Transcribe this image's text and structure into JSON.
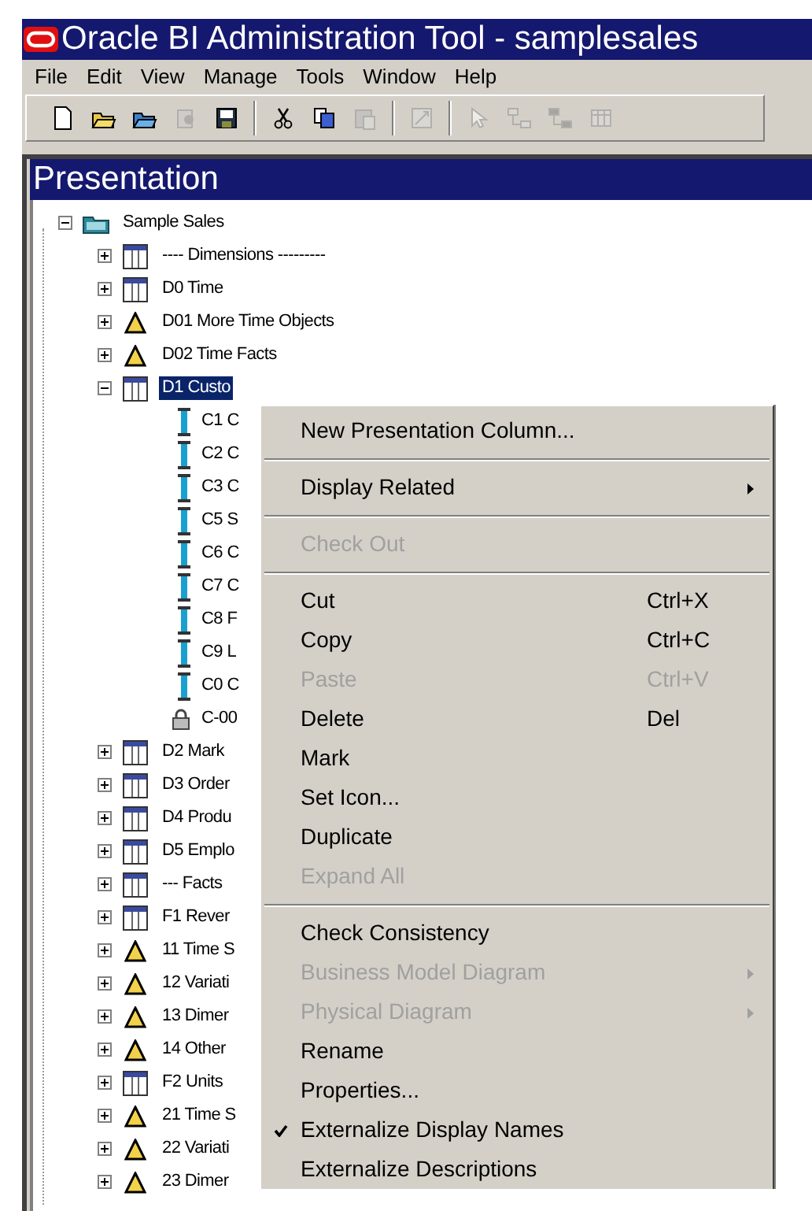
{
  "window": {
    "title": "Oracle BI Administration Tool - samplesales"
  },
  "menu_bar": [
    "File",
    "Edit",
    "View",
    "Manage",
    "Tools",
    "Window",
    "Help"
  ],
  "toolbar": [
    {
      "kind": "new",
      "disabled": false
    },
    {
      "kind": "open",
      "disabled": false
    },
    {
      "kind": "open-online",
      "disabled": false
    },
    {
      "kind": "check-in",
      "disabled": true
    },
    {
      "kind": "save",
      "disabled": false
    },
    {
      "kind": "separator"
    },
    {
      "kind": "cut",
      "disabled": false
    },
    {
      "kind": "copy",
      "disabled": false
    },
    {
      "kind": "paste",
      "disabled": true
    },
    {
      "kind": "separator"
    },
    {
      "kind": "resize",
      "disabled": true
    },
    {
      "kind": "separator"
    },
    {
      "kind": "pointer",
      "disabled": true
    },
    {
      "kind": "join",
      "disabled": true
    },
    {
      "kind": "complex-join",
      "disabled": true
    },
    {
      "kind": "grid",
      "disabled": true
    }
  ],
  "pane": {
    "title": "Presentation"
  },
  "tree": [
    {
      "label": "Sample Sales",
      "kind": "catalog",
      "expanded": true,
      "selected": false,
      "children": [
        {
          "label": "---- Dimensions ---------",
          "kind": "table",
          "expanded": false,
          "selected": false
        },
        {
          "label": "D0 Time",
          "kind": "table",
          "expanded": false,
          "selected": false
        },
        {
          "label": "D01 More Time Objects",
          "kind": "alias",
          "expanded": false,
          "selected": false
        },
        {
          "label": "D02 Time Facts",
          "kind": "alias",
          "expanded": false,
          "selected": false
        },
        {
          "label": "D1 Custo",
          "kind": "table",
          "expanded": true,
          "selected": true,
          "children": [
            {
              "label": "C1 C",
              "kind": "column",
              "selected": false
            },
            {
              "label": "C2 C",
              "kind": "column",
              "selected": false
            },
            {
              "label": "C3 C",
              "kind": "column",
              "selected": false
            },
            {
              "label": "C5 S",
              "kind": "column",
              "selected": false
            },
            {
              "label": "C6 C",
              "kind": "column",
              "selected": false
            },
            {
              "label": "C7 C",
              "kind": "column",
              "selected": false
            },
            {
              "label": "C8 F",
              "kind": "column",
              "selected": false
            },
            {
              "label": "C9 L",
              "kind": "column",
              "selected": false
            },
            {
              "label": "C0 C",
              "kind": "column",
              "selected": false
            },
            {
              "label": "C-00",
              "kind": "key",
              "selected": false
            }
          ]
        },
        {
          "label": "D2 Mark",
          "kind": "table",
          "expanded": false,
          "selected": false
        },
        {
          "label": "D3 Order",
          "kind": "table",
          "expanded": false,
          "selected": false
        },
        {
          "label": "D4 Produ",
          "kind": "table",
          "expanded": false,
          "selected": false
        },
        {
          "label": "D5 Emplo",
          "kind": "table",
          "expanded": false,
          "selected": false
        },
        {
          "label": "--- Facts",
          "kind": "table",
          "expanded": false,
          "selected": false
        },
        {
          "label": "F1 Rever",
          "kind": "table",
          "expanded": false,
          "selected": false
        },
        {
          "label": "11 Time S",
          "kind": "alias",
          "expanded": false,
          "selected": false
        },
        {
          "label": "12 Variati",
          "kind": "alias",
          "expanded": false,
          "selected": false
        },
        {
          "label": "13 Dimer",
          "kind": "alias",
          "expanded": false,
          "selected": false
        },
        {
          "label": "14 Other",
          "kind": "alias",
          "expanded": false,
          "selected": false
        },
        {
          "label": "F2 Units",
          "kind": "table",
          "expanded": false,
          "selected": false
        },
        {
          "label": "21 Time S",
          "kind": "alias",
          "expanded": false,
          "selected": false
        },
        {
          "label": "22 Variati",
          "kind": "alias",
          "expanded": false,
          "selected": false
        },
        {
          "label": "23 Dimer",
          "kind": "alias",
          "expanded": false,
          "selected": false
        }
      ]
    }
  ],
  "context_menu": [
    {
      "kind": "item",
      "label": "New Presentation Column...",
      "disabled": false
    },
    {
      "kind": "separator"
    },
    {
      "kind": "item",
      "label": "Display Related",
      "disabled": false,
      "submenu": true
    },
    {
      "kind": "separator"
    },
    {
      "kind": "item",
      "label": "Check Out",
      "disabled": true
    },
    {
      "kind": "separator"
    },
    {
      "kind": "item",
      "label": "Cut",
      "shortcut": "Ctrl+X",
      "disabled": false
    },
    {
      "kind": "item",
      "label": "Copy",
      "shortcut": "Ctrl+C",
      "disabled": false
    },
    {
      "kind": "item",
      "label": "Paste",
      "shortcut": "Ctrl+V",
      "disabled": true
    },
    {
      "kind": "item",
      "label": "Delete",
      "shortcut": "Del",
      "disabled": false
    },
    {
      "kind": "item",
      "label": "Mark",
      "disabled": false
    },
    {
      "kind": "item",
      "label": "Set Icon...",
      "disabled": false
    },
    {
      "kind": "item",
      "label": "Duplicate",
      "disabled": false
    },
    {
      "kind": "item",
      "label": "Expand All",
      "disabled": true
    },
    {
      "kind": "separator"
    },
    {
      "kind": "item",
      "label": "Check Consistency",
      "disabled": false
    },
    {
      "kind": "item",
      "label": "Business Model Diagram",
      "disabled": true,
      "submenu": true
    },
    {
      "kind": "item",
      "label": "Physical Diagram",
      "disabled": true,
      "submenu": true
    },
    {
      "kind": "item",
      "label": "Rename",
      "disabled": false
    },
    {
      "kind": "item",
      "label": "Properties...",
      "disabled": false
    },
    {
      "kind": "item",
      "label": "Externalize Display Names",
      "disabled": false,
      "checked": true
    },
    {
      "kind": "item",
      "label": "Externalize Descriptions",
      "disabled": false,
      "checked": false
    }
  ]
}
